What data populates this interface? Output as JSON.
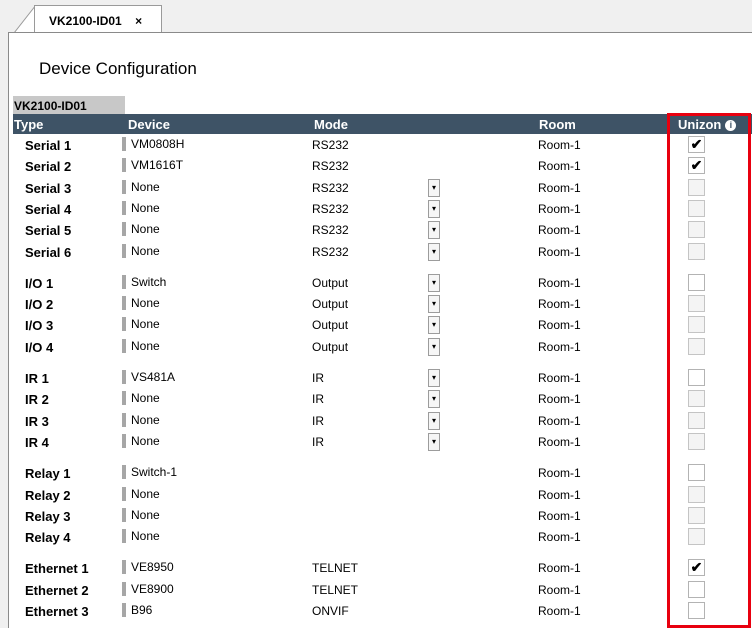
{
  "tab": {
    "label": "VK2100-ID01",
    "close": "×"
  },
  "page_title": "Device Configuration",
  "device_label": "VK2100-ID01",
  "columns": {
    "type": "Type",
    "device": "Device",
    "mode": "Mode",
    "room": "Room",
    "unizon": "Unizon",
    "info": "i"
  },
  "rows": [
    {
      "type": "Serial 1",
      "device": "VM0808H",
      "mode": "RS232",
      "dropdown": false,
      "room": "Room-1",
      "checked": true,
      "enabled": true
    },
    {
      "type": "Serial 2",
      "device": "VM1616T",
      "mode": "RS232",
      "dropdown": false,
      "room": "Room-1",
      "checked": true,
      "enabled": true
    },
    {
      "type": "Serial 3",
      "device": "None",
      "mode": "RS232",
      "dropdown": true,
      "room": "Room-1",
      "checked": false,
      "enabled": false
    },
    {
      "type": "Serial 4",
      "device": "None",
      "mode": "RS232",
      "dropdown": true,
      "room": "Room-1",
      "checked": false,
      "enabled": false
    },
    {
      "type": "Serial 5",
      "device": "None",
      "mode": "RS232",
      "dropdown": true,
      "room": "Room-1",
      "checked": false,
      "enabled": false
    },
    {
      "type": "Serial 6",
      "device": "None",
      "mode": "RS232",
      "dropdown": true,
      "room": "Room-1",
      "checked": false,
      "enabled": false
    },
    {
      "type": "I/O 1",
      "device": "Switch",
      "mode": "Output",
      "dropdown": true,
      "room": "Room-1",
      "checked": false,
      "enabled": true
    },
    {
      "type": "I/O 2",
      "device": "None",
      "mode": "Output",
      "dropdown": true,
      "room": "Room-1",
      "checked": false,
      "enabled": false
    },
    {
      "type": "I/O 3",
      "device": "None",
      "mode": "Output",
      "dropdown": true,
      "room": "Room-1",
      "checked": false,
      "enabled": false
    },
    {
      "type": "I/O 4",
      "device": "None",
      "mode": "Output",
      "dropdown": true,
      "room": "Room-1",
      "checked": false,
      "enabled": false
    },
    {
      "type": "IR 1",
      "device": "VS481A",
      "mode": "IR",
      "dropdown": true,
      "room": "Room-1",
      "checked": false,
      "enabled": true
    },
    {
      "type": "IR 2",
      "device": "None",
      "mode": "IR",
      "dropdown": true,
      "room": "Room-1",
      "checked": false,
      "enabled": false
    },
    {
      "type": "IR 3",
      "device": "None",
      "mode": "IR",
      "dropdown": true,
      "room": "Room-1",
      "checked": false,
      "enabled": false
    },
    {
      "type": "IR 4",
      "device": "None",
      "mode": "IR",
      "dropdown": true,
      "room": "Room-1",
      "checked": false,
      "enabled": false
    },
    {
      "type": "Relay 1",
      "device": "Switch-1",
      "mode": "",
      "dropdown": false,
      "room": "Room-1",
      "checked": false,
      "enabled": true
    },
    {
      "type": "Relay 2",
      "device": "None",
      "mode": "",
      "dropdown": false,
      "room": "Room-1",
      "checked": false,
      "enabled": false
    },
    {
      "type": "Relay 3",
      "device": "None",
      "mode": "",
      "dropdown": false,
      "room": "Room-1",
      "checked": false,
      "enabled": false
    },
    {
      "type": "Relay 4",
      "device": "None",
      "mode": "",
      "dropdown": false,
      "room": "Room-1",
      "checked": false,
      "enabled": false
    },
    {
      "type": "Ethernet 1",
      "device": "VE8950",
      "mode": "TELNET",
      "dropdown": false,
      "room": "Room-1",
      "checked": true,
      "enabled": true
    },
    {
      "type": "Ethernet 2",
      "device": "VE8900",
      "mode": "TELNET",
      "dropdown": false,
      "room": "Room-1",
      "checked": false,
      "enabled": true
    },
    {
      "type": "Ethernet 3",
      "device": "B96",
      "mode": "ONVIF",
      "dropdown": false,
      "room": "Room-1",
      "checked": false,
      "enabled": true
    }
  ],
  "colors": {
    "header_bg": "#3e5366",
    "highlight": "#e8000f",
    "device_marker": "#a6a6a6"
  },
  "icons": {
    "checkmark": "✔",
    "dropdown": "▾"
  }
}
